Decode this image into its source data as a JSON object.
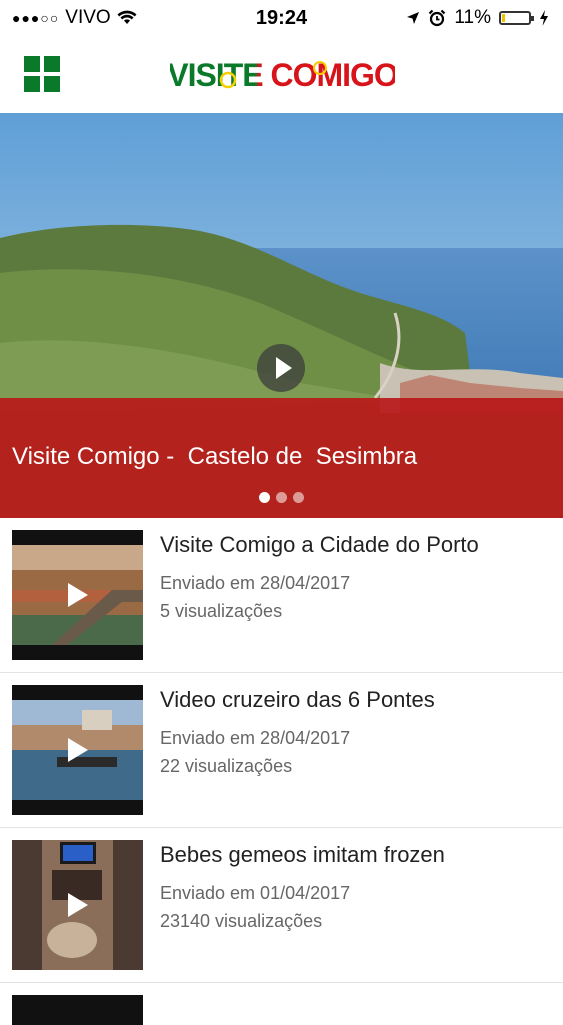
{
  "status_bar": {
    "signal_dots": "●●●○○",
    "carrier": "VIVO",
    "time": "19:24",
    "battery_percent": "11%",
    "battery_level": 0.11,
    "icons": [
      "wifi-icon",
      "location-arrow-icon",
      "alarm-clock-icon",
      "battery-icon",
      "charging-bolt-icon"
    ]
  },
  "nav": {
    "menu_icon": "grid-cross-menu-icon",
    "logo_text": "VISITE COMIGO",
    "colors": {
      "green": "#0a7a2a",
      "red": "#d7141a",
      "yellow": "#f5d000"
    }
  },
  "hero": {
    "caption": "Visite Comigo -  Castelo de  Sesimbra",
    "band_color": "#b91919",
    "slides_count": 3,
    "active_slide": 1
  },
  "videos": [
    {
      "title": "Visite Comigo a Cidade do Porto",
      "date": "Enviado em 28/04/2017",
      "views": "5 visualizações"
    },
    {
      "title": "Video cruzeiro das 6 Pontes",
      "date": "Enviado em 28/04/2017",
      "views": "22 visualizações"
    },
    {
      "title": "Bebes gemeos imitam frozen",
      "date": "Enviado em 01/04/2017",
      "views": "23140 visualizações"
    }
  ]
}
